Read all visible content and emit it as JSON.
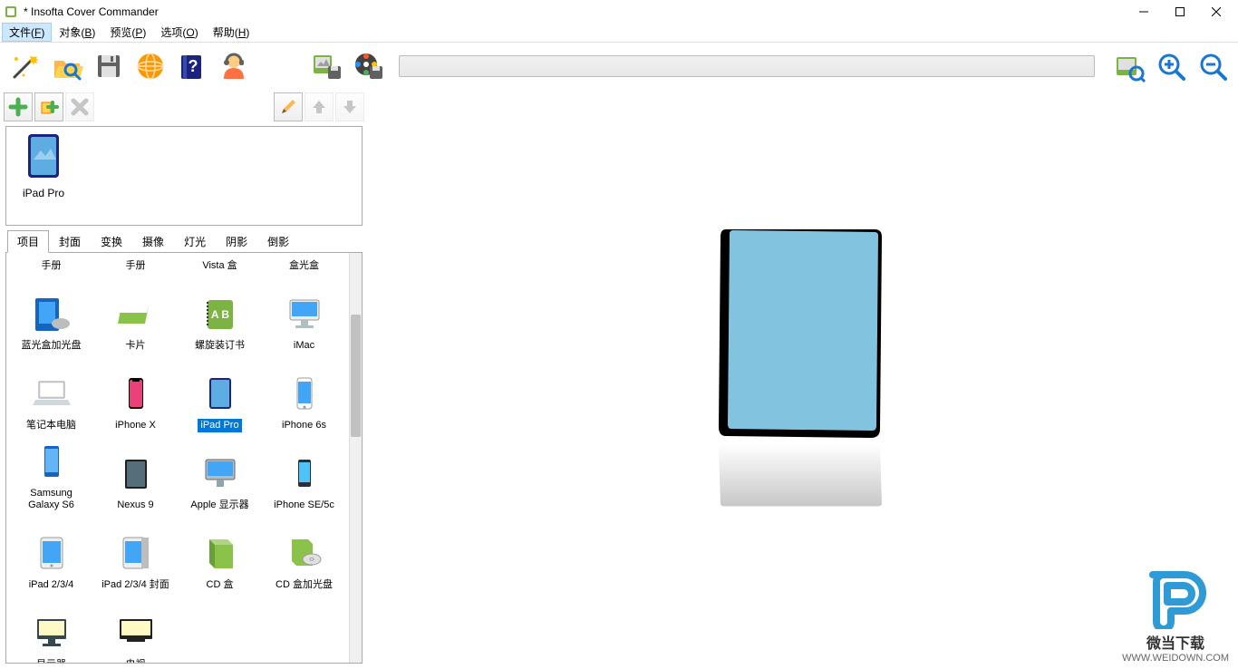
{
  "title": "* Insofta Cover Commander",
  "menus": [
    "文件(F)",
    "对象(B)",
    "预览(P)",
    "选项(O)",
    "帮助(H)"
  ],
  "active_menu_index": 0,
  "chosen_item_label": "iPad Pro",
  "tabs": [
    "项目",
    "封面",
    "变换",
    "摄像",
    "灯光",
    "阴影",
    "倒影"
  ],
  "gallery_items": [
    {
      "label": "手册",
      "icon": "book"
    },
    {
      "label": "手册",
      "icon": "book"
    },
    {
      "label": "Vista 盒",
      "icon": "box-green"
    },
    {
      "label": "盒光盒",
      "icon": "box-blue"
    },
    {
      "label": "蓝光盒加光盘",
      "icon": "bluray"
    },
    {
      "label": "卡片",
      "icon": "card"
    },
    {
      "label": "螺旋装订书",
      "icon": "spiral"
    },
    {
      "label": "iMac",
      "icon": "imac"
    },
    {
      "label": "笔记本电脑",
      "icon": "laptop"
    },
    {
      "label": "iPhone X",
      "icon": "phone-notch"
    },
    {
      "label": "iPad Pro",
      "icon": "ipad",
      "selected": true
    },
    {
      "label": "iPhone 6s",
      "icon": "phone"
    },
    {
      "label": "Samsung Galaxy S6",
      "icon": "phone-samsung"
    },
    {
      "label": "Nexus 9",
      "icon": "tablet-dark"
    },
    {
      "label": "Apple 显示器",
      "icon": "display"
    },
    {
      "label": "iPhone SE/5c",
      "icon": "phone-small"
    },
    {
      "label": "iPad 2/3/4",
      "icon": "ipad-old"
    },
    {
      "label": "iPad 2/3/4 封面",
      "icon": "ipad-cover"
    },
    {
      "label": "CD 盒",
      "icon": "cdbox"
    },
    {
      "label": "CD 盒加光盘",
      "icon": "cdbox-disc"
    },
    {
      "label": "显示器",
      "icon": "monitor"
    },
    {
      "label": "电视",
      "icon": "tv"
    }
  ],
  "watermark": {
    "title": "微当下载",
    "link": "WWW.WEIDOWN.COM"
  }
}
